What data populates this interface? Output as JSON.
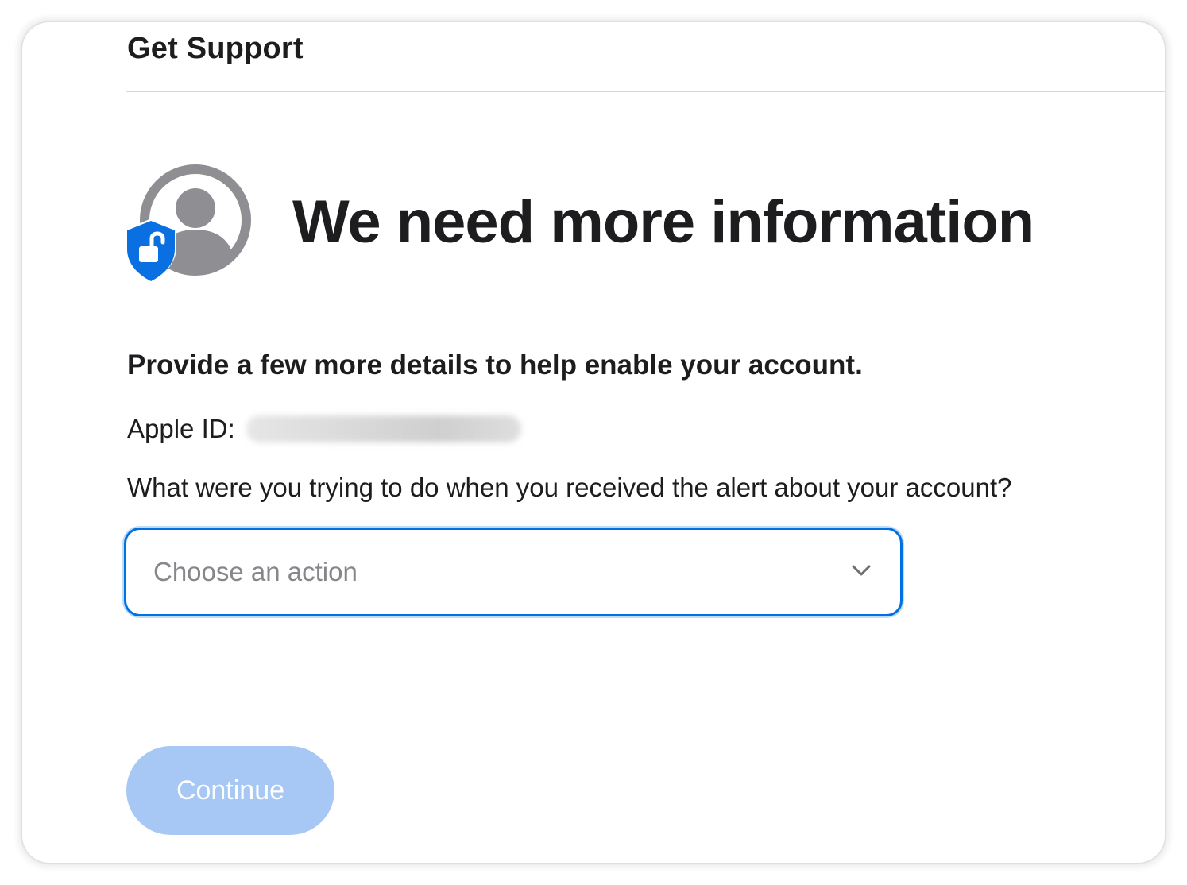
{
  "header": {
    "title": "Get Support"
  },
  "hero": {
    "icon": "account-lock-icon",
    "headline": "We need more information"
  },
  "form": {
    "subheading": "Provide a few more details to help enable your account.",
    "apple_id_label": "Apple ID:",
    "apple_id_value": "",
    "question": "What were you trying to do when you received the alert about your account?",
    "select": {
      "placeholder": "Choose an action",
      "icon": "chevron-down-icon"
    },
    "continue_label": "Continue"
  },
  "colors": {
    "accent": "#0071e3",
    "button_disabled": "#a7c8f4",
    "text_primary": "#1d1d1f",
    "text_placeholder": "#86868b",
    "shield_blue": "#0a6fe0",
    "avatar_gray": "#8e8e93"
  }
}
